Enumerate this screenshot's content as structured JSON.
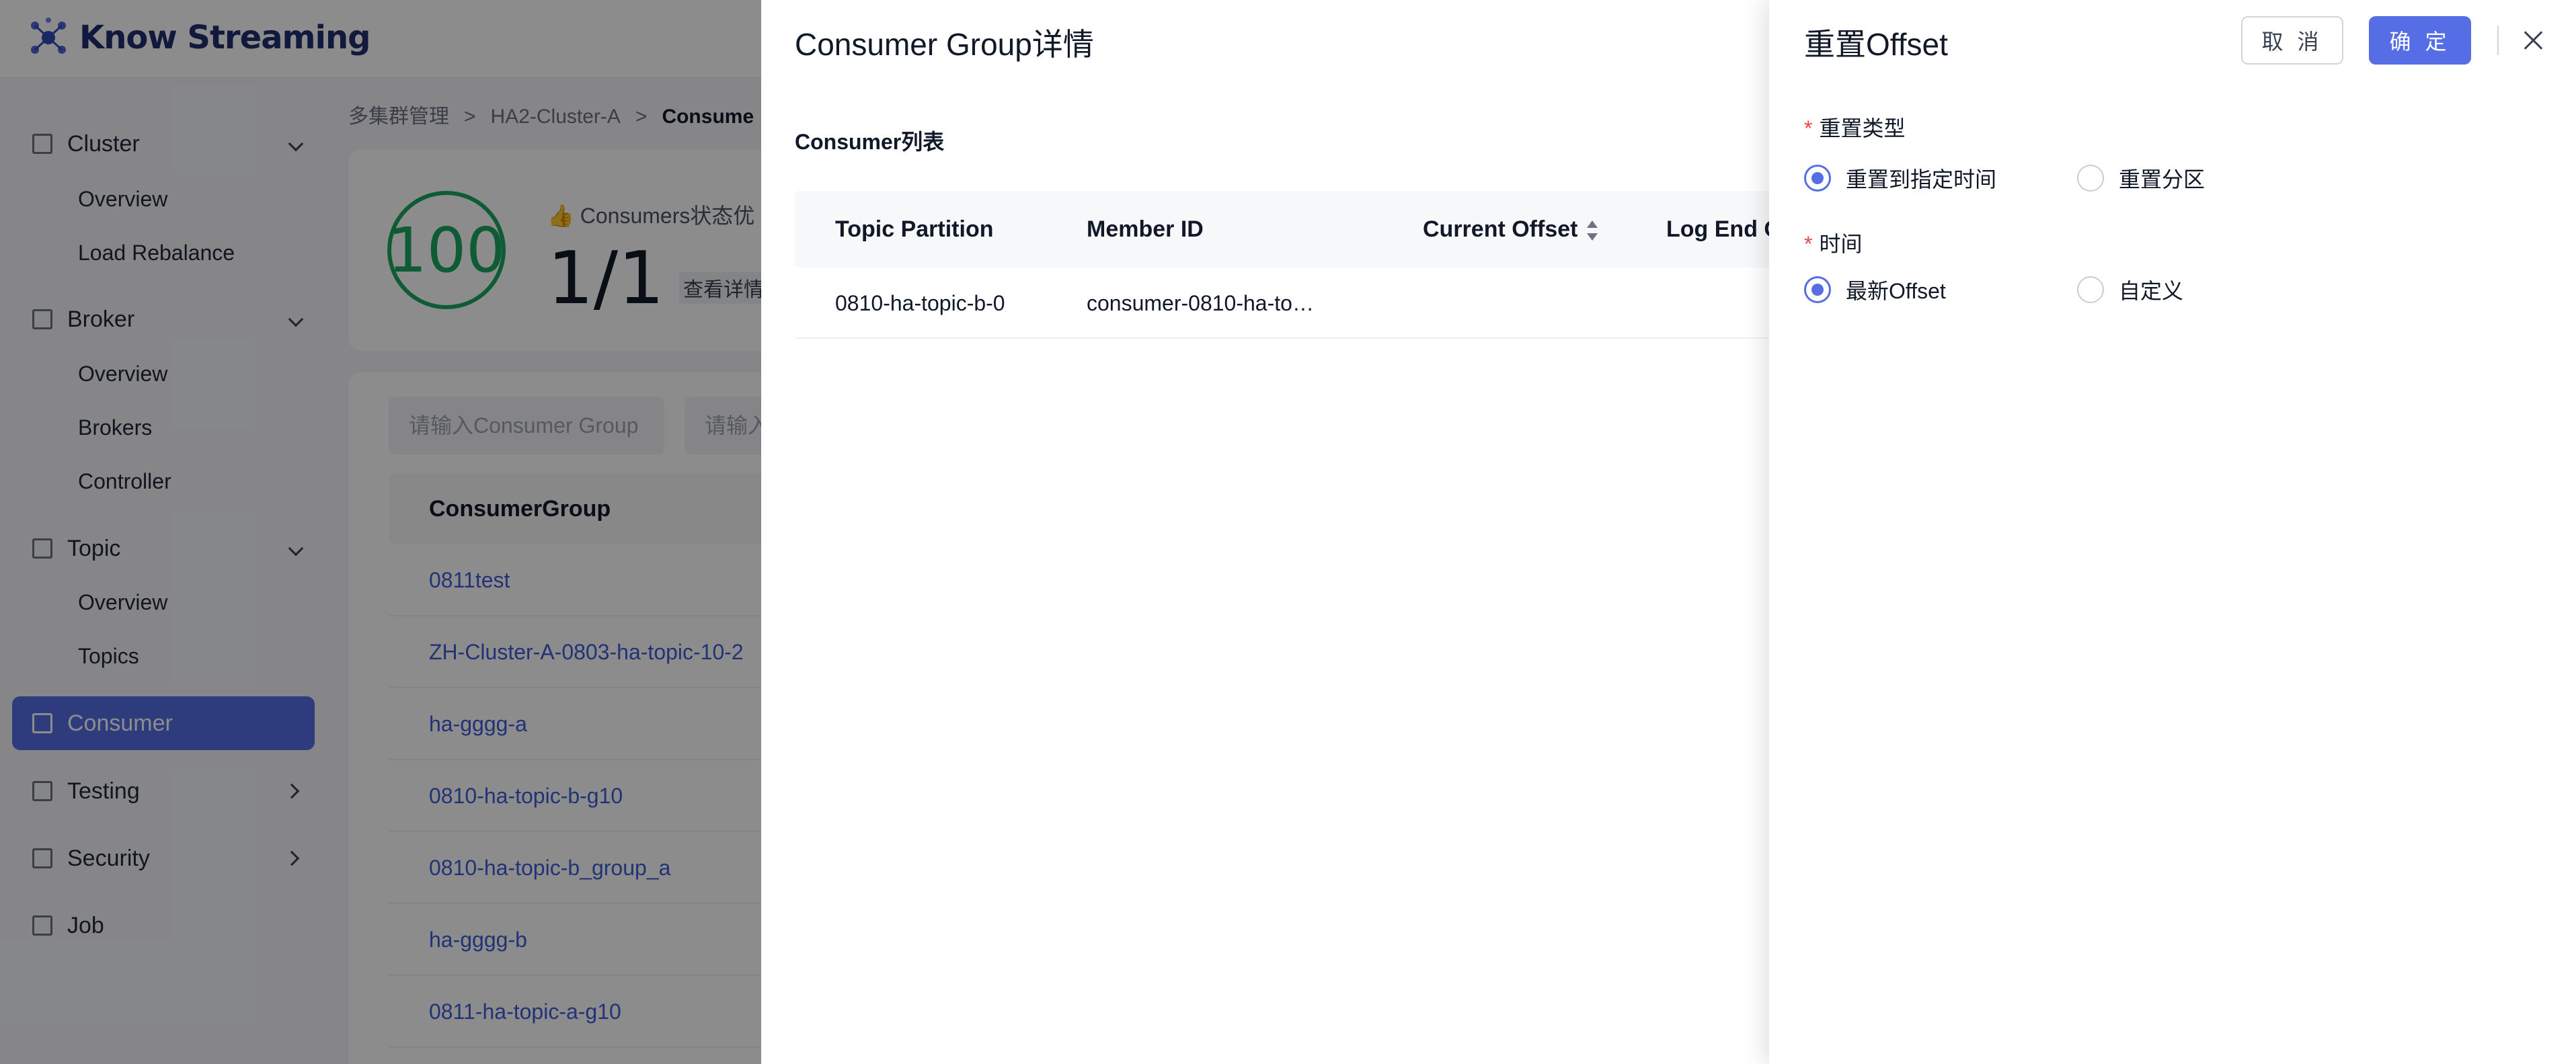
{
  "app": {
    "name": "Know Streaming"
  },
  "sidebar": {
    "groups": [
      {
        "label": "Cluster",
        "items": [
          "Overview",
          "Load Rebalance"
        ]
      },
      {
        "label": "Broker",
        "items": [
          "Overview",
          "Brokers",
          "Controller"
        ]
      },
      {
        "label": "Topic",
        "items": [
          "Overview",
          "Topics"
        ]
      }
    ],
    "active": "Consumer",
    "more": [
      "Testing",
      "Security",
      "Job"
    ]
  },
  "breadcrumb": {
    "root": "多集群管理",
    "cluster": "HA2-Cluster-A",
    "current": "Consume"
  },
  "health": {
    "score": "100",
    "status": "👍 Consumers状态优",
    "count": "1/1",
    "link": "查看详情"
  },
  "filters": {
    "group_placeholder": "请输入Consumer Group",
    "topic_placeholder": "请输入"
  },
  "consumer_groups": {
    "header": "ConsumerGroup",
    "rows": [
      "0811test",
      "ZH-Cluster-A-0803-ha-topic-10-2",
      "ha-gggg-a",
      "0810-ha-topic-b-g10",
      "0810-ha-topic-b_group_a",
      "ha-gggg-b",
      "0811-ha-topic-a-g10"
    ]
  },
  "detail": {
    "title": "Consumer Group详情",
    "section": "Consumer列表",
    "columns": [
      "Topic Partition",
      "Member ID",
      "Current Offset",
      "Log End O"
    ],
    "rows": [
      {
        "topic_partition": "0810-ha-topic-b-0",
        "member_id": "consumer-0810-ha-to…"
      }
    ]
  },
  "reset": {
    "title": "重置Offset",
    "cancel": "取 消",
    "ok": "确 定",
    "type_label": "重置类型",
    "type_options": [
      "重置到指定时间",
      "重置分区"
    ],
    "type_selected": "重置到指定时间",
    "time_label": "时间",
    "time_options": [
      "最新Offset",
      "自定义"
    ],
    "time_selected": "最新Offset",
    "required_mark": "*"
  },
  "colors": {
    "accent": "#556ee6",
    "health": "#1aa663",
    "link": "#3f5bd8",
    "required": "#ef4444"
  }
}
